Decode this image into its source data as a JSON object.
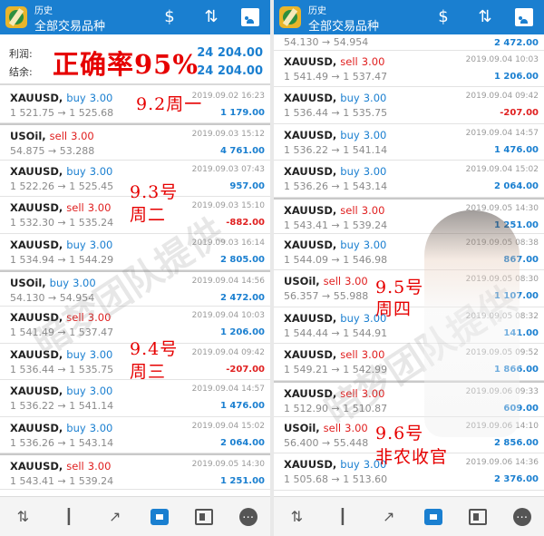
{
  "app": {
    "subtitle": "历史",
    "title": "全部交易品种"
  },
  "summary": {
    "profit_label": "利润:",
    "profit_value": "24 204.00",
    "balance_label": "结余:",
    "balance_value": "24 204.00"
  },
  "overlay_rate": "正确率95%",
  "notes": {
    "mon": "9.2周一",
    "tue_1": "9.3号",
    "tue_2": "周二",
    "wed_1": "9.4号",
    "wed_2": "周三",
    "thu_1": "9.5号",
    "thu_2": "周四",
    "fri_1": "9.6号",
    "fri_2": "非农收官"
  },
  "watermark": "暗梦团队提供",
  "left_orders": [
    {
      "symbol": "XAUUSD",
      "side": "buy",
      "volume": "3.00",
      "prices": "1 521.75 → 1 525.68",
      "time": "2019.09.02 16:23",
      "profit": "1 179.00"
    },
    {
      "symbol": "USOil",
      "side": "sell",
      "volume": "3.00",
      "prices": "54.875 → 53.288",
      "time": "2019.09.03 15:12",
      "profit": "4 761.00"
    },
    {
      "symbol": "XAUUSD",
      "side": "buy",
      "volume": "3.00",
      "prices": "1 522.26 → 1 525.45",
      "time": "2019.09.03 07:43",
      "profit": "957.00"
    },
    {
      "symbol": "XAUUSD",
      "side": "sell",
      "volume": "3.00",
      "prices": "1 532.30 → 1 535.24",
      "time": "2019.09.03 15:10",
      "profit": "-882.00"
    },
    {
      "symbol": "XAUUSD",
      "side": "buy",
      "volume": "3.00",
      "prices": "1 534.94 → 1 544.29",
      "time": "2019.09.03 16:14",
      "profit": "2 805.00"
    },
    {
      "symbol": "USOil",
      "side": "buy",
      "volume": "3.00",
      "prices": "54.130 → 54.954",
      "time": "2019.09.04 14:56",
      "profit": "2 472.00"
    },
    {
      "symbol": "XAUUSD",
      "side": "sell",
      "volume": "3.00",
      "prices": "1 541.49 → 1 537.47",
      "time": "2019.09.04 10:03",
      "profit": "1 206.00"
    },
    {
      "symbol": "XAUUSD",
      "side": "buy",
      "volume": "3.00",
      "prices": "1 536.44 → 1 535.75",
      "time": "2019.09.04 09:42",
      "profit": "-207.00"
    },
    {
      "symbol": "XAUUSD",
      "side": "buy",
      "volume": "3.00",
      "prices": "1 536.22 → 1 541.14",
      "time": "2019.09.04 14:57",
      "profit": "1 476.00"
    },
    {
      "symbol": "XAUUSD",
      "side": "buy",
      "volume": "3.00",
      "prices": "1 536.26 → 1 543.14",
      "time": "2019.09.04 15:02",
      "profit": "2 064.00"
    },
    {
      "symbol": "XAUUSD",
      "side": "sell",
      "volume": "3.00",
      "prices": "1 543.41 → 1 539.24",
      "time": "2019.09.05 14:30",
      "profit": "1 251.00"
    }
  ],
  "right_top_partial": {
    "prices": "54.130 → 54.954",
    "profit": "2 472.00"
  },
  "right_orders": [
    {
      "symbol": "XAUUSD",
      "side": "sell",
      "volume": "3.00",
      "prices": "1 541.49 → 1 537.47",
      "time": "2019.09.04 10:03",
      "profit": "1 206.00"
    },
    {
      "symbol": "XAUUSD",
      "side": "buy",
      "volume": "3.00",
      "prices": "1 536.44 → 1 535.75",
      "time": "2019.09.04 09:42",
      "profit": "-207.00"
    },
    {
      "symbol": "XAUUSD",
      "side": "buy",
      "volume": "3.00",
      "prices": "1 536.22 → 1 541.14",
      "time": "2019.09.04 14:57",
      "profit": "1 476.00"
    },
    {
      "symbol": "XAUUSD",
      "side": "buy",
      "volume": "3.00",
      "prices": "1 536.26 → 1 543.14",
      "time": "2019.09.04 15:02",
      "profit": "2 064.00"
    },
    {
      "symbol": "XAUUSD",
      "side": "sell",
      "volume": "3.00",
      "prices": "1 543.41 → 1 539.24",
      "time": "2019.09.05 14:30",
      "profit": "1 251.00"
    },
    {
      "symbol": "XAUUSD",
      "side": "buy",
      "volume": "3.00",
      "prices": "1 544.09 → 1 546.98",
      "time": "2019.09.05 08:38",
      "profit": "867.00"
    },
    {
      "symbol": "USOil",
      "side": "sell",
      "volume": "3.00",
      "prices": "56.357 → 55.988",
      "time": "2019.09.05 08:30",
      "profit": "1 107.00"
    },
    {
      "symbol": "XAUUSD",
      "side": "buy",
      "volume": "3.00",
      "prices": "1 544.44 → 1 544.91",
      "time": "2019.09.05 08:32",
      "profit": "141.00"
    },
    {
      "symbol": "XAUUSD",
      "side": "sell",
      "volume": "3.00",
      "prices": "1 549.21 → 1 542.99",
      "time": "2019.09.05 09:52",
      "profit": "1 866.00"
    },
    {
      "symbol": "XAUUSD",
      "side": "sell",
      "volume": "3.00",
      "prices": "1 512.90 → 1 510.87",
      "time": "2019.09.06 09:33",
      "profit": "609.00"
    },
    {
      "symbol": "USOil",
      "side": "sell",
      "volume": "3.00",
      "prices": "56.400 → 55.448",
      "time": "2019.09.06 14:10",
      "profit": "2 856.00"
    },
    {
      "symbol": "XAUUSD",
      "side": "buy",
      "volume": "3.00",
      "prices": "1 505.68 → 1 513.60",
      "time": "2019.09.06 14:36",
      "profit": "2 376.00"
    }
  ],
  "bottom_nav": [
    "quotes-icon",
    "chart-icon",
    "trade-icon",
    "history-icon",
    "news-icon",
    "chat-icon"
  ],
  "colors": {
    "accent": "#1a7fd0",
    "buy": "#1a7fd0",
    "sell": "#e02020",
    "annotation": "#e60000"
  }
}
